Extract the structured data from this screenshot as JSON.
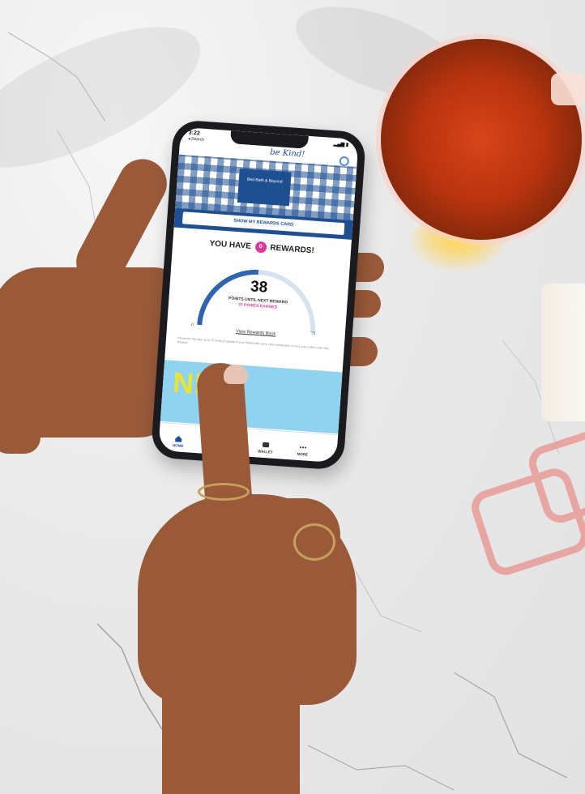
{
  "phone": {
    "status_time": "3:22",
    "status_back": "◂ Search",
    "status_battery": "▂▄▆ ▮",
    "script_logo": "be Kind!",
    "brand_badge": "Bed Bath & Beyond",
    "rewards_card_button": "SHOW MY REWARDS CARD",
    "headline_prefix": "YOU HAVE",
    "reward_count": "0",
    "headline_suffix": "REWARDS!",
    "points_value": "38",
    "points_label": "POINTS UNTIL NEXT REWARD",
    "points_earned": "37 POINTS EARNED",
    "gauge_min": "0",
    "gauge_max": "75",
    "gauge_progress": 0.49,
    "view_rewards_link": "View Rewards Book",
    "fine_print": "*Rewards may take up to 72 hours to appear in your Wallet after up to close transaction or once your online order has shipped.",
    "promo_text": "NEW",
    "tabs": [
      {
        "label": "HOME",
        "icon": "home-icon",
        "active": true
      },
      {
        "label": "",
        "icon": "",
        "active": false
      },
      {
        "label": "WALLET",
        "icon": "wallet-icon",
        "active": false
      },
      {
        "label": "MORE",
        "icon": "more-icon",
        "active": false
      }
    ]
  },
  "colors": {
    "brand_blue": "#1d4f91",
    "accent_pink": "#d93a9a",
    "tea": "#b8330e",
    "skin": "#9a5a3a",
    "marble": "#eeeeee"
  }
}
